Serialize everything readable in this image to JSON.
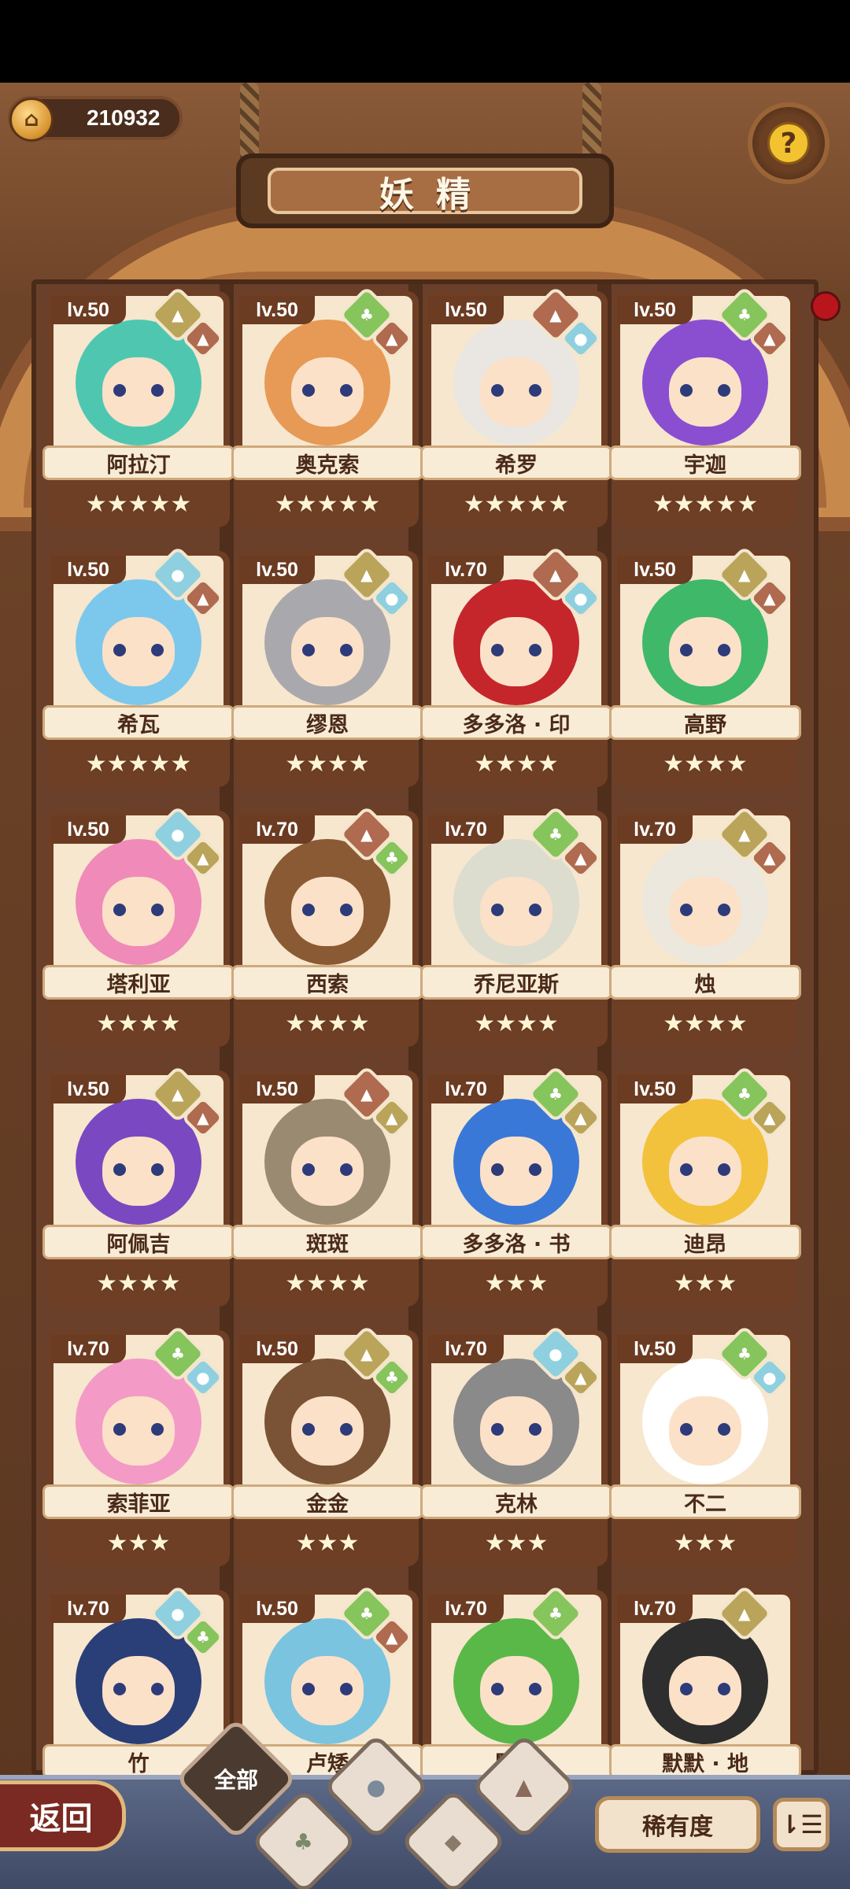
{
  "header": {
    "currency_amount": "210932",
    "title": "妖精",
    "help_symbol": "?"
  },
  "colors": {
    "plant": "#86c45c",
    "earth": "#b9a45a",
    "rock": "#b06a4f",
    "water": "#8ed0df"
  },
  "fairies": [
    {
      "level": "lv.50",
      "name": "阿拉汀",
      "stars": "★★★★★",
      "elements": [
        "earth",
        "rock"
      ],
      "hair": "#4fc7b0"
    },
    {
      "level": "lv.50",
      "name": "奥克索",
      "stars": "★★★★★",
      "elements": [
        "plant",
        "rock"
      ],
      "hair": "#e79a55"
    },
    {
      "level": "lv.50",
      "name": "希罗",
      "stars": "★★★★★",
      "elements": [
        "rock",
        "water"
      ],
      "hair": "#eae7e2"
    },
    {
      "level": "lv.50",
      "name": "宇迦",
      "stars": "★★★★★",
      "elements": [
        "plant",
        "rock"
      ],
      "hair": "#8a4fd0"
    },
    {
      "level": "lv.50",
      "name": "希瓦",
      "stars": "★★★★★",
      "elements": [
        "water",
        "rock"
      ],
      "hair": "#7cc8ec"
    },
    {
      "level": "lv.50",
      "name": "缪恩",
      "stars": "★★★★",
      "elements": [
        "earth",
        "water"
      ],
      "hair": "#a9a9ad"
    },
    {
      "level": "lv.70",
      "name": "多多洛 · 印",
      "stars": "★★★★",
      "elements": [
        "rock",
        "water"
      ],
      "hair": "#c4262c"
    },
    {
      "level": "lv.50",
      "name": "高野",
      "stars": "★★★★",
      "elements": [
        "earth",
        "rock"
      ],
      "hair": "#3fb86a"
    },
    {
      "level": "lv.50",
      "name": "塔利亚",
      "stars": "★★★★",
      "elements": [
        "water",
        "earth"
      ],
      "hair": "#f08ab8"
    },
    {
      "level": "lv.70",
      "name": "西索",
      "stars": "★★★★",
      "elements": [
        "rock",
        "plant"
      ],
      "hair": "#8a5a34"
    },
    {
      "level": "lv.70",
      "name": "乔尼亚斯",
      "stars": "★★★★",
      "elements": [
        "plant",
        "rock"
      ],
      "hair": "#dcdccf"
    },
    {
      "level": "lv.70",
      "name": "烛",
      "stars": "★★★★",
      "elements": [
        "earth",
        "rock"
      ],
      "hair": "#ece8de"
    },
    {
      "level": "lv.50",
      "name": "阿佩吉",
      "stars": "★★★★",
      "elements": [
        "earth",
        "rock"
      ],
      "hair": "#7a48c0"
    },
    {
      "level": "lv.50",
      "name": "斑斑",
      "stars": "★★★★",
      "elements": [
        "rock",
        "earth"
      ],
      "hair": "#9a8a72"
    },
    {
      "level": "lv.70",
      "name": "多多洛 · 书",
      "stars": "★★★",
      "elements": [
        "plant",
        "earth"
      ],
      "hair": "#3a78d8"
    },
    {
      "level": "lv.50",
      "name": "迪昂",
      "stars": "★★★",
      "elements": [
        "plant",
        "earth"
      ],
      "hair": "#f2c23c"
    },
    {
      "level": "lv.70",
      "name": "索菲亚",
      "stars": "★★★",
      "elements": [
        "plant",
        "water"
      ],
      "hair": "#f39ac6"
    },
    {
      "level": "lv.50",
      "name": "金金",
      "stars": "★★★",
      "elements": [
        "earth",
        "plant"
      ],
      "hair": "#7a5236"
    },
    {
      "level": "lv.70",
      "name": "克林",
      "stars": "★★★",
      "elements": [
        "water",
        "earth"
      ],
      "hair": "#8a8a8a"
    },
    {
      "level": "lv.50",
      "name": "不二",
      "stars": "★★★",
      "elements": [
        "plant",
        "water"
      ],
      "hair": "#ffffff"
    },
    {
      "level": "lv.70",
      "name": "竹",
      "stars": "",
      "elements": [
        "water",
        "plant"
      ],
      "hair": "#2a3e78"
    },
    {
      "level": "lv.50",
      "name": "卢矮",
      "stars": "",
      "elements": [
        "plant",
        "rock"
      ],
      "hair": "#7ac4e0"
    },
    {
      "level": "lv.70",
      "name": "默默",
      "stars": "",
      "elements": [
        "plant"
      ],
      "hair": "#5ab848"
    },
    {
      "level": "lv.70",
      "name": "默默 · 地",
      "stars": "",
      "elements": [
        "earth"
      ],
      "hair": "#2e2e2e"
    }
  ],
  "bottom": {
    "back_label": "返回",
    "tab_all": "全部",
    "rarity_label": "稀有度",
    "sort_symbol": "⇂☰"
  }
}
